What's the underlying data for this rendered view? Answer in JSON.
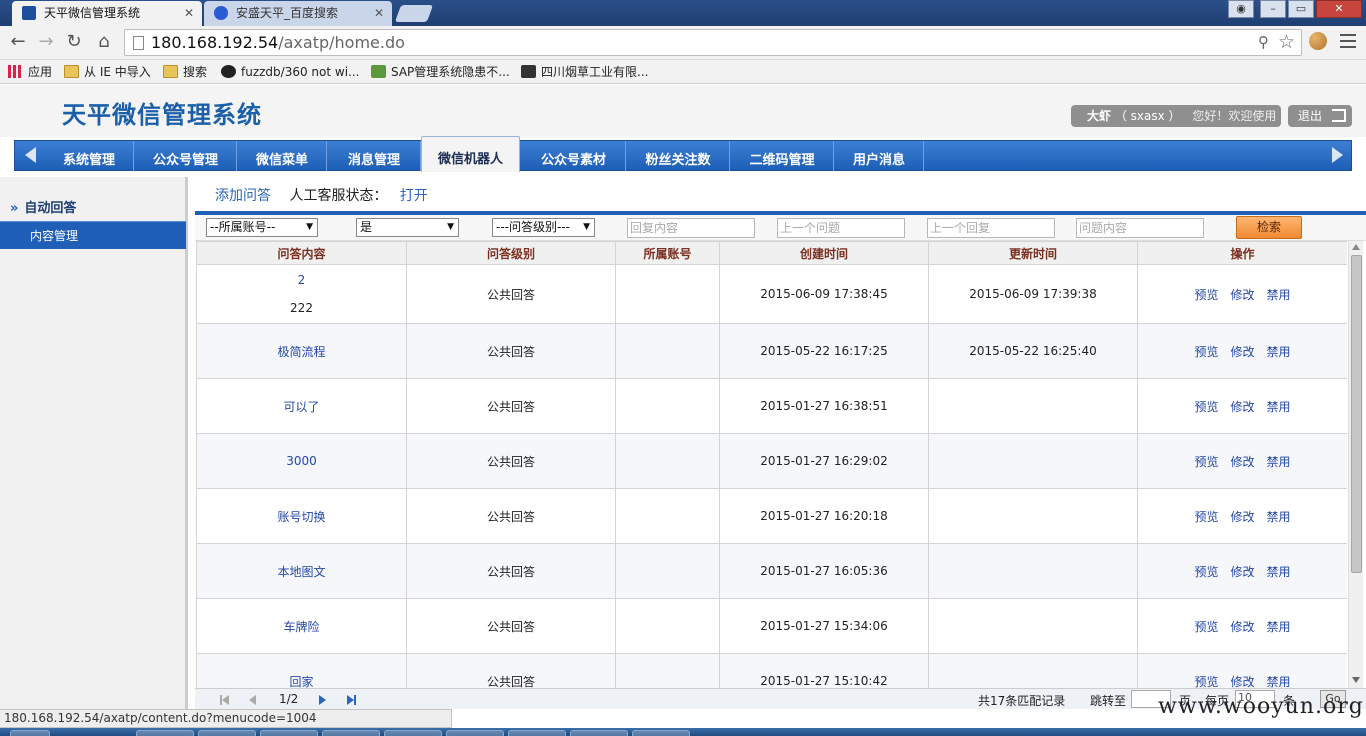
{
  "browser": {
    "tabs": [
      {
        "title": "天平微信管理系统",
        "active": true
      },
      {
        "title": "安盛天平_百度搜索",
        "active": false
      }
    ],
    "url_host": "180.168.192.54",
    "url_path": "/axatp/home.do",
    "bookmarks": [
      {
        "label": "应用",
        "icon": "apps-icon"
      },
      {
        "label": "从 IE 中导入",
        "icon": "folder-icon"
      },
      {
        "label": "搜索",
        "icon": "folder-icon"
      },
      {
        "label": "fuzzdb/360 not wi...",
        "icon": "github-icon"
      },
      {
        "label": "SAP管理系统隐患不...",
        "icon": "check-icon"
      },
      {
        "label": "四川烟草工业有限...",
        "icon": "photo-icon"
      }
    ],
    "status_url": "180.168.192.54/axatp/content.do?menucode=1004"
  },
  "header": {
    "title": "天平微信管理系统",
    "user_name": "大虾",
    "user_id": "（ sxasx ）",
    "welcome": "您好！欢迎使用",
    "logout": "退出"
  },
  "nav": {
    "items": [
      "系统管理",
      "公众号管理",
      "微信菜单",
      "消息管理",
      "微信机器人",
      "公众号素材",
      "粉丝关注数",
      "二维码管理",
      "用户消息"
    ],
    "active": "微信机器人"
  },
  "sidebar": {
    "section": "自动回答",
    "items": [
      "内容管理"
    ]
  },
  "content": {
    "add_link": "添加问答",
    "service_label": "人工客服状态：",
    "service_value": "打开"
  },
  "filters": {
    "account_select": "--所属账号--",
    "yes_select": "是",
    "level_select": "---问答级别---",
    "reply_placeholder": "回复内容",
    "prev_question_placeholder": "上一个问题",
    "prev_reply_placeholder": "上一个回复",
    "question_placeholder": "问题内容",
    "search_label": "检索"
  },
  "table": {
    "columns": [
      "问答内容",
      "问答级别",
      "所属账号",
      "创建时间",
      "更新时间",
      "操作"
    ],
    "actions": [
      "预览",
      "修改",
      "禁用"
    ],
    "rows": [
      {
        "question": "2",
        "sub": "222",
        "level": "公共回答",
        "account": "",
        "created": "2015-06-09 17:38:45",
        "updated": "2015-06-09 17:39:38"
      },
      {
        "question": "极简流程",
        "sub": "",
        "level": "公共回答",
        "account": "",
        "created": "2015-05-22 16:17:25",
        "updated": "2015-05-22 16:25:40"
      },
      {
        "question": "可以了",
        "sub": "",
        "level": "公共回答",
        "account": "",
        "created": "2015-01-27 16:38:51",
        "updated": ""
      },
      {
        "question": "3000",
        "sub": "",
        "level": "公共回答",
        "account": "",
        "created": "2015-01-27 16:29:02",
        "updated": ""
      },
      {
        "question": "账号切换",
        "sub": "",
        "level": "公共回答",
        "account": "",
        "created": "2015-01-27 16:20:18",
        "updated": ""
      },
      {
        "question": "本地图文",
        "sub": "",
        "level": "公共回答",
        "account": "",
        "created": "2015-01-27 16:05:36",
        "updated": ""
      },
      {
        "question": "车牌险",
        "sub": "",
        "level": "公共回答",
        "account": "",
        "created": "2015-01-27 15:34:06",
        "updated": ""
      },
      {
        "question": "回家",
        "sub": "",
        "level": "公共回答",
        "account": "",
        "created": "2015-01-27 15:10:42",
        "updated": ""
      }
    ]
  },
  "pager": {
    "page_info": "1/2",
    "total": "共17条匹配记录",
    "jump_label": "跳转至",
    "page_unit": "页",
    "size_label": "每页",
    "size_value": "10",
    "size_unit": "条",
    "go": "Go"
  },
  "watermark": "www.wooyun.org",
  "colors": {
    "brand_blue": "#1d5fb6",
    "title_blue": "#1b5fa9",
    "header_red": "#7b2f20",
    "search_orange": "#f08a33"
  }
}
